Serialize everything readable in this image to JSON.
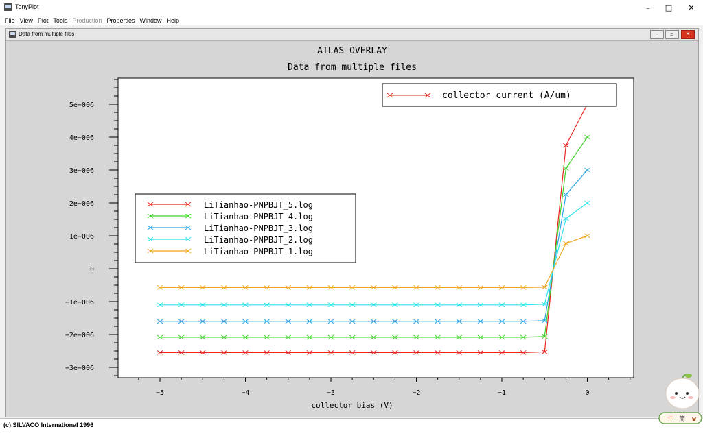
{
  "app": {
    "title": "TonyPlot"
  },
  "window_controls": {
    "minimize": "–",
    "maximize": "□",
    "close": "✕"
  },
  "menu": [
    {
      "label": "File",
      "enabled": true
    },
    {
      "label": "View",
      "enabled": true
    },
    {
      "label": "Plot",
      "enabled": true
    },
    {
      "label": "Tools",
      "enabled": true
    },
    {
      "label": "Production",
      "enabled": false
    },
    {
      "label": "Properties",
      "enabled": true
    },
    {
      "label": "Window",
      "enabled": true
    },
    {
      "label": "Help",
      "enabled": true
    }
  ],
  "subwindow": {
    "title": "Data from multiple files"
  },
  "status": {
    "text": "(c) SILVACO International 1996"
  },
  "mascot": {
    "chars": [
      "中",
      "简"
    ]
  },
  "chart_data": {
    "type": "line",
    "title": "ATLAS OVERLAY",
    "subtitle": "Data from multiple files",
    "xlabel": "collector bias (V)",
    "ylabel": "",
    "xlim": [
      -5.5,
      0.5
    ],
    "ylim": [
      -3.35e-06,
      5.8e-06
    ],
    "xticks": [
      -5,
      -4,
      -3,
      -2,
      -1,
      0
    ],
    "xtick_labels": [
      "−5",
      "−4",
      "−3",
      "−2",
      "−1",
      "0"
    ],
    "yticks": [
      5e-06,
      4e-06,
      3e-06,
      2e-06,
      1e-06,
      0,
      -1e-06,
      -2e-06,
      -3e-06
    ],
    "ytick_labels": [
      "5e−006",
      "4e−006",
      "3e−006",
      "2e−006",
      "1e−006",
      "0",
      "−1e−006",
      "−2e−006",
      "−3e−006"
    ],
    "quantity_legend": {
      "label": "collector current (A/um)",
      "color": "#e6261f"
    },
    "x": [
      -5,
      -4.75,
      -4.5,
      -4.25,
      -4,
      -3.75,
      -3.5,
      -3.25,
      -3,
      -2.75,
      -2.5,
      -2.25,
      -2,
      -1.75,
      -1.5,
      -1.25,
      -1,
      -0.75,
      -0.5,
      -0.25,
      0
    ],
    "series": [
      {
        "name": "LiTianhao-PNPBJT_5.log",
        "color": "#e6261f",
        "values": [
          -2.55e-06,
          -2.55e-06,
          -2.55e-06,
          -2.55e-06,
          -2.55e-06,
          -2.55e-06,
          -2.55e-06,
          -2.55e-06,
          -2.55e-06,
          -2.55e-06,
          -2.55e-06,
          -2.55e-06,
          -2.55e-06,
          -2.55e-06,
          -2.55e-06,
          -2.55e-06,
          -2.55e-06,
          -2.55e-06,
          -2.53e-06,
          3.75e-06,
          5e-06
        ]
      },
      {
        "name": "LiTianhao-PNPBJT_4.log",
        "color": "#3fd12a",
        "values": [
          -2.08e-06,
          -2.08e-06,
          -2.08e-06,
          -2.08e-06,
          -2.08e-06,
          -2.08e-06,
          -2.08e-06,
          -2.08e-06,
          -2.08e-06,
          -2.08e-06,
          -2.08e-06,
          -2.08e-06,
          -2.08e-06,
          -2.08e-06,
          -2.08e-06,
          -2.08e-06,
          -2.08e-06,
          -2.08e-06,
          -2.06e-06,
          3.05e-06,
          4e-06
        ]
      },
      {
        "name": "LiTianhao-PNPBJT_3.log",
        "color": "#2aa5e6",
        "values": [
          -1.6e-06,
          -1.6e-06,
          -1.6e-06,
          -1.6e-06,
          -1.6e-06,
          -1.6e-06,
          -1.6e-06,
          -1.6e-06,
          -1.6e-06,
          -1.6e-06,
          -1.6e-06,
          -1.6e-06,
          -1.6e-06,
          -1.6e-06,
          -1.6e-06,
          -1.6e-06,
          -1.6e-06,
          -1.6e-06,
          -1.58e-06,
          2.25e-06,
          3e-06
        ]
      },
      {
        "name": "LiTianhao-PNPBJT_2.log",
        "color": "#2ee3ec",
        "values": [
          -1.1e-06,
          -1.1e-06,
          -1.1e-06,
          -1.1e-06,
          -1.1e-06,
          -1.1e-06,
          -1.1e-06,
          -1.1e-06,
          -1.1e-06,
          -1.1e-06,
          -1.1e-06,
          -1.1e-06,
          -1.1e-06,
          -1.1e-06,
          -1.1e-06,
          -1.1e-06,
          -1.1e-06,
          -1.1e-06,
          -1.08e-06,
          1.52e-06,
          2e-06
        ]
      },
      {
        "name": "LiTianhao-PNPBJT_1.log",
        "color": "#f2a51f",
        "values": [
          -5.7e-07,
          -5.7e-07,
          -5.7e-07,
          -5.7e-07,
          -5.7e-07,
          -5.7e-07,
          -5.7e-07,
          -5.7e-07,
          -5.7e-07,
          -5.7e-07,
          -5.7e-07,
          -5.7e-07,
          -5.7e-07,
          -5.7e-07,
          -5.7e-07,
          -5.7e-07,
          -5.7e-07,
          -5.7e-07,
          -5.6e-07,
          7.7e-07,
          1e-06
        ]
      }
    ]
  }
}
